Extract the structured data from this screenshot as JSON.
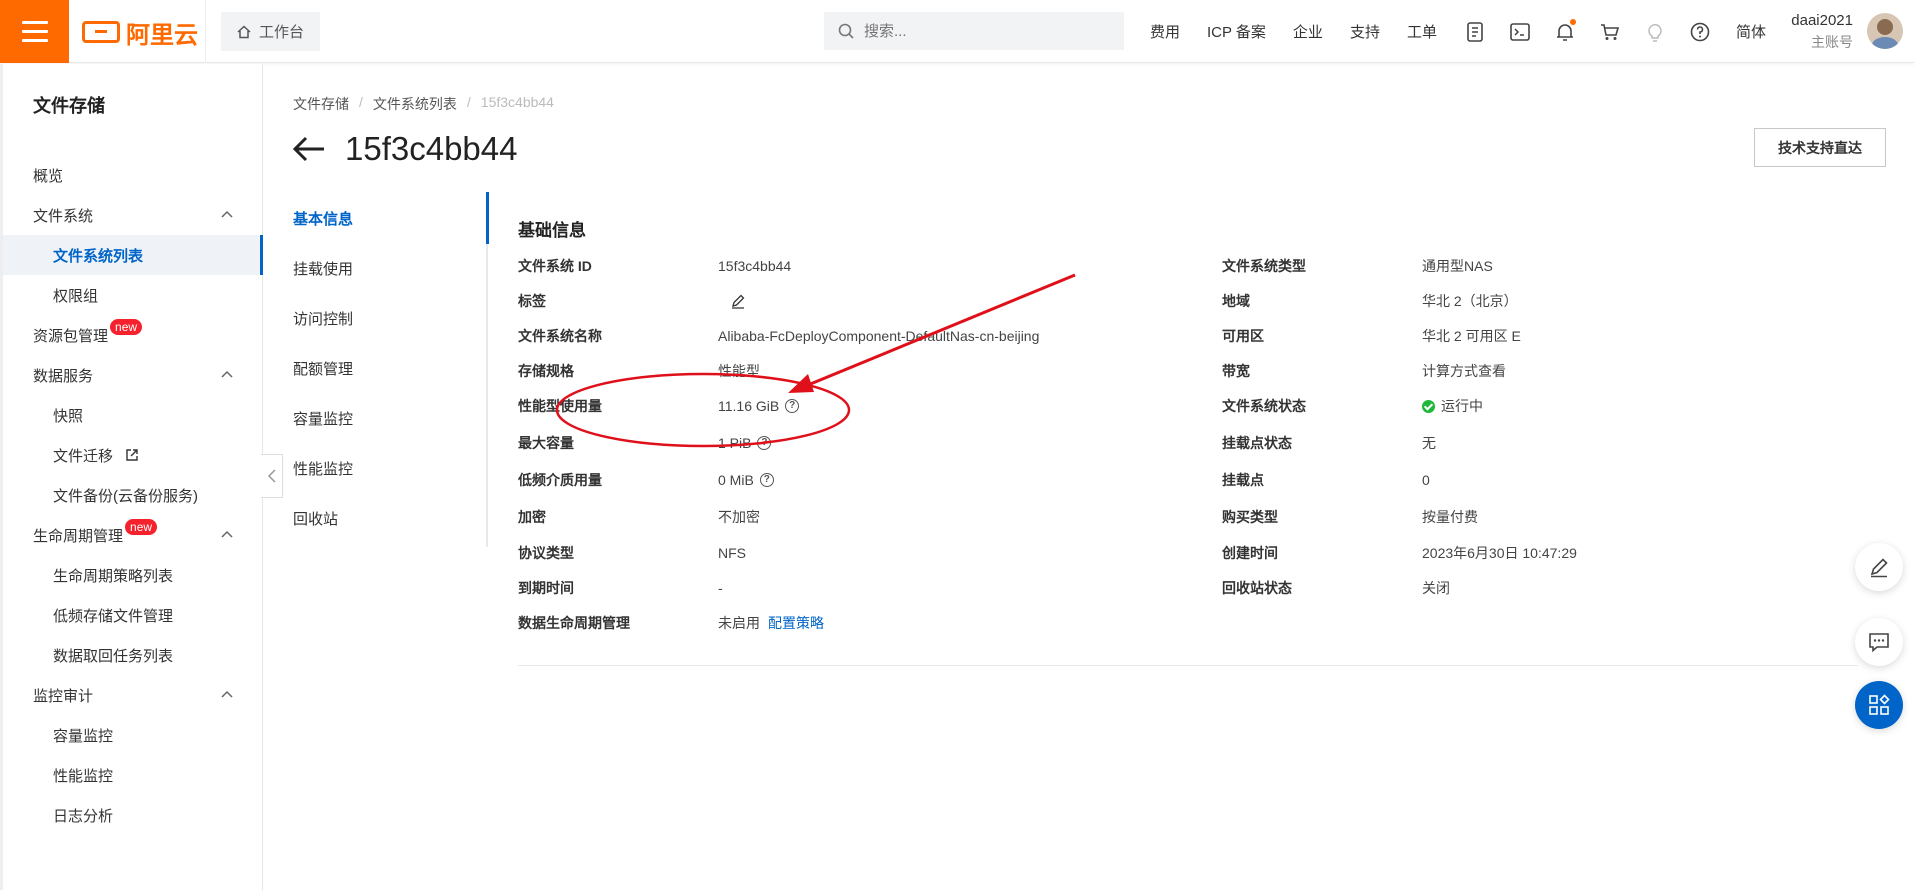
{
  "header": {
    "logo_text": "阿里云",
    "workbench_label": "工作台",
    "search_placeholder": "搜索...",
    "nav": [
      "费用",
      "ICP 备案",
      "企业",
      "支持",
      "工单"
    ],
    "lang": "简体",
    "user_name": "daai2021",
    "user_role": "主账号",
    "accent_color": "#ff6a00"
  },
  "sidebar": {
    "title": "文件存储",
    "items": [
      {
        "label": "概览"
      },
      {
        "label": "文件系统"
      },
      {
        "label": "文件系统列表"
      },
      {
        "label": "权限组"
      },
      {
        "label": "资源包管理",
        "badge": "new"
      },
      {
        "label": "数据服务"
      },
      {
        "label": "快照"
      },
      {
        "label": "文件迁移"
      },
      {
        "label": "文件备份(云备份服务)"
      },
      {
        "label": "生命周期管理",
        "badge": "new"
      },
      {
        "label": "生命周期策略列表"
      },
      {
        "label": "低频存储文件管理"
      },
      {
        "label": "数据取回任务列表"
      },
      {
        "label": "监控审计"
      },
      {
        "label": "容量监控"
      },
      {
        "label": "性能监控"
      },
      {
        "label": "日志分析"
      }
    ]
  },
  "breadcrumb": [
    "文件存储",
    "文件系统列表",
    "15f3c4bb44"
  ],
  "page": {
    "title": "15f3c4bb44",
    "support_button": "技术支持直达"
  },
  "tabs": [
    "基本信息",
    "挂载使用",
    "访问控制",
    "配额管理",
    "容量监控",
    "性能监控",
    "回收站"
  ],
  "basic": {
    "section_title": "基础信息",
    "left": [
      {
        "label": "文件系统 ID",
        "value": "15f3c4bb44"
      },
      {
        "label": "标签",
        "value": ""
      },
      {
        "label": "文件系统名称",
        "value": "Alibaba-FcDeployComponent-DefaultNas-cn-beijing"
      },
      {
        "label": "存储规格",
        "value": "性能型"
      },
      {
        "label": "性能型使用量",
        "value": "11.16 GiB"
      },
      {
        "label": "最大容量",
        "value": "1 PiB"
      },
      {
        "label": "低频介质用量",
        "value": "0 MiB"
      },
      {
        "label": "加密",
        "value": "不加密"
      },
      {
        "label": "协议类型",
        "value": "NFS"
      },
      {
        "label": "到期时间",
        "value": "-"
      },
      {
        "label": "数据生命周期管理",
        "value": "未启用",
        "link": "配置策略"
      }
    ],
    "right": [
      {
        "label": "文件系统类型",
        "value": "通用型NAS"
      },
      {
        "label": "地域",
        "value": "华北 2（北京）"
      },
      {
        "label": "可用区",
        "value": "华北 2 可用区 E"
      },
      {
        "label": "带宽",
        "value": "计算方式查看"
      },
      {
        "label": "文件系统状态",
        "value": "运行中"
      },
      {
        "label": "挂载点状态",
        "value": "无"
      },
      {
        "label": "挂载点",
        "value": "0"
      },
      {
        "label": "购买类型",
        "value": "按量付费"
      },
      {
        "label": "创建时间",
        "value": "2023年6月30日 10:47:29"
      },
      {
        "label": "回收站状态",
        "value": "关闭"
      }
    ]
  }
}
